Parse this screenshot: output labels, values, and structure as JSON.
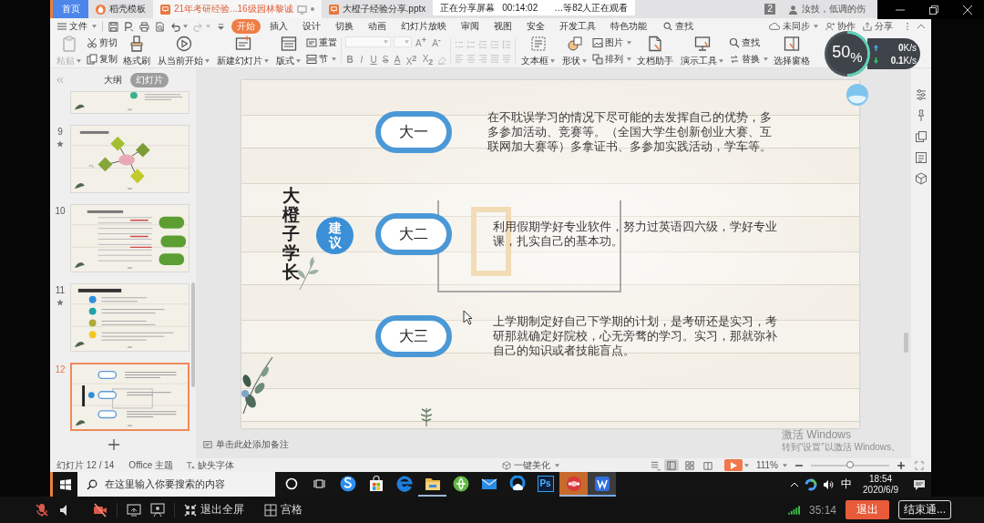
{
  "title_bar": {
    "tabs": [
      {
        "label": "首页",
        "kind": "home",
        "selected": false
      },
      {
        "label": "稻壳模板",
        "kind": "template",
        "selected": false
      },
      {
        "label": "21年考研经验...16级园林黎诚",
        "kind": "document",
        "selected": true
      },
      {
        "label": "大橙子经验分享.pptx",
        "kind": "document",
        "selected": false
      }
    ],
    "share_banner": {
      "status": "正在分享屏幕",
      "timer": "00:14:02",
      "viewers": "…等82人正在观看"
    },
    "badge": "2",
    "user_name": "汝技，低调的伤"
  },
  "menu_bar": {
    "file": "文件",
    "tabs": [
      {
        "label": "开始",
        "selected": true
      },
      {
        "label": "插入",
        "selected": false
      },
      {
        "label": "设计",
        "selected": false
      },
      {
        "label": "切换",
        "selected": false
      },
      {
        "label": "动画",
        "selected": false
      },
      {
        "label": "幻灯片放映",
        "selected": false
      },
      {
        "label": "审阅",
        "selected": false
      },
      {
        "label": "视图",
        "selected": false
      },
      {
        "label": "安全",
        "selected": false
      },
      {
        "label": "开发工具",
        "selected": false
      },
      {
        "label": "特色功能",
        "selected": false
      }
    ],
    "search": "查找",
    "sync": "未同步",
    "collaborate": "协作",
    "share": "分享"
  },
  "ribbon": {
    "left": [
      {
        "kind": "large",
        "label": "粘贴",
        "dropdown": true,
        "disabled": true
      },
      {
        "kind": "pair",
        "items": [
          {
            "label": "剪切",
            "dropdown": false,
            "disabled": false
          },
          {
            "label": "复制",
            "dropdown": false,
            "disabled": false
          }
        ]
      },
      {
        "kind": "large",
        "label": "格式刷",
        "dropdown": false,
        "disabled": false
      },
      {
        "kind": "large",
        "label": "从当前开始",
        "dropdown": true,
        "disabled": false
      },
      {
        "kind": "large",
        "label": "新建幻灯片",
        "dropdown": true,
        "disabled": false
      },
      {
        "kind": "large",
        "label": "版式",
        "dropdown": true,
        "disabled": false
      },
      {
        "kind": "pair",
        "items": [
          {
            "label": "重置",
            "dropdown": false,
            "disabled": false
          },
          {
            "label": "节",
            "dropdown": true,
            "disabled": false
          }
        ]
      }
    ],
    "font": {
      "disabled": true,
      "size_buttons": [
        "A$^{+}$",
        "A$^{-}$"
      ],
      "format_buttons": [
        "B",
        "I",
        "U",
        "S",
        "A",
        "X$^{2}$",
        "X$_{2}$"
      ]
    },
    "paragraph": {
      "disabled": true
    },
    "right": [
      {
        "kind": "large",
        "label": "文本框",
        "dropdown": true,
        "disabled": false
      },
      {
        "kind": "large",
        "label": "形状",
        "dropdown": true,
        "disabled": false
      },
      {
        "kind": "pair",
        "items": [
          {
            "label": "图片",
            "dropdown": true,
            "disabled": false
          },
          {
            "label": "排列",
            "dropdown": true,
            "disabled": false
          }
        ]
      },
      {
        "kind": "large",
        "label": "文档助手",
        "dropdown": false,
        "disabled": false
      },
      {
        "kind": "large",
        "label": "演示工具",
        "dropdown": true,
        "disabled": false
      },
      {
        "kind": "pair",
        "items": [
          {
            "label": "查找",
            "dropdown": false,
            "disabled": false
          },
          {
            "label": "替换",
            "dropdown": true,
            "disabled": false
          }
        ]
      },
      {
        "kind": "large",
        "label": "选择窗格",
        "dropdown": false,
        "disabled": false
      }
    ]
  },
  "network_monitor": {
    "percent": "50$_{%}$",
    "level": 0.5,
    "upload": "**0**K/s",
    "download": "**0.1**K/s"
  },
  "left_panel": {
    "view_tabs": [
      {
        "label": "大纲",
        "selected": false
      },
      {
        "label": "幻灯片",
        "selected": true
      }
    ],
    "thumbnails": [
      {
        "kind": "partial",
        "selected": false,
        "animated": false
      },
      {
        "number": "9",
        "kind": "diagram",
        "selected": false,
        "animated": true
      },
      {
        "number": "10",
        "kind": "table",
        "selected": false,
        "animated": false
      },
      {
        "number": "11",
        "kind": "list",
        "selected": false,
        "animated": true
      },
      {
        "number": "12",
        "kind": "steps",
        "selected": true,
        "animated": false
      }
    ]
  },
  "slide": {
    "title": "大橙子学长",
    "badge": "建议",
    "items": [
      {
        "label": "大一",
        "text": "在不耽误学习的情况下尽可能的去发挥自己的优势，多多参加活动、竞赛等。（全国大学生创新创业大赛、互联网加大赛等）多拿证书、多参加实践活动，学车等。"
      },
      {
        "label": "大二",
        "text": "利用假期学好专业软件，努力过英语四六级，学好专业课，扎实自己的基本功。"
      },
      {
        "label": "大三",
        "text": "上学期制定好自己下学期的计划，是考研还是实习，考研那就确定好院校，心无旁骛的学习。实习，那就弥补自己的知识或者技能盲点。"
      }
    ]
  },
  "notes": {
    "placeholder": "单击此处添加备注"
  },
  "activation_notice": {
    "title": "激活 Windows",
    "hint": "转到“设置”以激活 Windows。"
  },
  "status_bar": {
    "slide_info": "幻灯片 12 / 14",
    "theme": "Office 主题",
    "missing_fonts": "缺失字体",
    "beautify": "一键美化",
    "views": [
      {
        "kind": "normal",
        "selected": true
      },
      {
        "kind": "sorter",
        "selected": false
      },
      {
        "kind": "reading",
        "selected": false
      }
    ],
    "zoom": "111%",
    "zoom_slider": {
      "level": 0.5
    }
  },
  "taskbar": {
    "search_placeholder": "在这里输入你要搜索的内容",
    "apps": [
      {
        "kind": "swirl",
        "running": false,
        "selected": false,
        "flashing": false
      },
      {
        "kind": "store",
        "running": false,
        "selected": false,
        "flashing": false
      },
      {
        "kind": "browser",
        "running": false,
        "selected": false,
        "flashing": false
      },
      {
        "kind": "folder",
        "running": true,
        "selected": false,
        "flashing": false
      },
      {
        "kind": "globe",
        "running": false,
        "selected": false,
        "flashing": false
      },
      {
        "kind": "mail",
        "running": false,
        "selected": false,
        "flashing": false
      },
      {
        "kind": "cloud",
        "running": false,
        "selected": false,
        "flashing": false
      },
      {
        "kind": "ps",
        "label": "Ps",
        "running": false,
        "selected": false,
        "flashing": false
      },
      {
        "kind": "round",
        "running": true,
        "selected": false,
        "flashing": true
      },
      {
        "kind": "tile",
        "running": true,
        "selected": true,
        "flashing": false
      }
    ],
    "ime": "中",
    "time": "18:54",
    "date": "2020/6/9"
  },
  "meeting_bar": {
    "mic_muted": true,
    "camera_off": true,
    "exit_fullscreen": "退出全屏",
    "grid": "宫格",
    "duration": "35:14",
    "leave": "退出",
    "end": "结束通..."
  }
}
